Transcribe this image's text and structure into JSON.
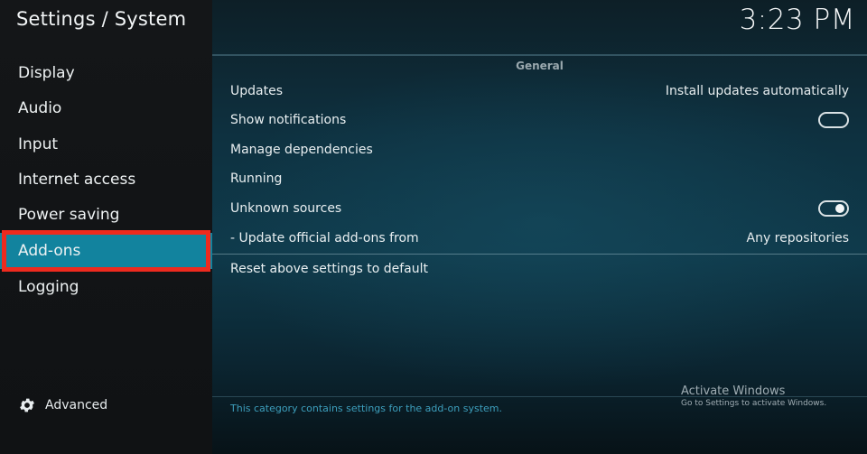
{
  "header": {
    "title": "Settings / System",
    "clock": "3:23 PM"
  },
  "sidebar": {
    "items": [
      {
        "label": "Display"
      },
      {
        "label": "Audio"
      },
      {
        "label": "Input"
      },
      {
        "label": "Internet access"
      },
      {
        "label": "Power saving"
      },
      {
        "label": "Add-ons",
        "selected": true
      },
      {
        "label": "Logging"
      }
    ],
    "advanced": {
      "label": "Advanced",
      "icon": "gear-icon"
    }
  },
  "main": {
    "section_title": "General",
    "settings": [
      {
        "label": "Updates",
        "value": "Install updates automatically"
      },
      {
        "label": "Show notifications",
        "toggle": "off"
      },
      {
        "label": "Manage dependencies"
      },
      {
        "label": "Running"
      },
      {
        "label": "Unknown sources",
        "toggle": "on"
      },
      {
        "label": "- Update official add-ons from",
        "value": "Any repositories"
      }
    ],
    "reset_label": "Reset above settings to default",
    "description": "This category contains settings for the add-on system."
  },
  "watermark": {
    "title": "Activate Windows",
    "subtitle": "Go to Settings to activate Windows."
  },
  "colors": {
    "selected_item": "#12839e",
    "highlight_outline": "#ee2a1e",
    "description_text": "#3d9fbd"
  }
}
